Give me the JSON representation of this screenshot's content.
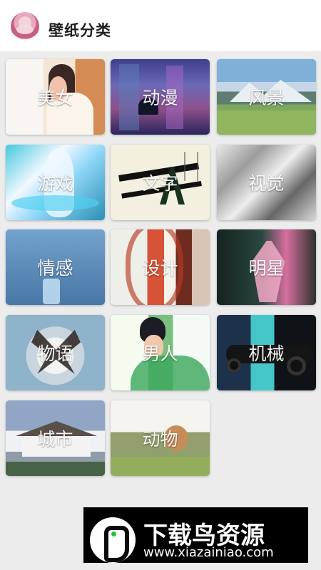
{
  "header": {
    "title": "壁纸分类",
    "avatar_icon": "user-avatar"
  },
  "categories": [
    {
      "label": "美女",
      "art": "t1"
    },
    {
      "label": "动漫",
      "art": "t2"
    },
    {
      "label": "风景",
      "art": "t3"
    },
    {
      "label": "游戏",
      "art": "t4"
    },
    {
      "label": "文字",
      "art": "t5"
    },
    {
      "label": "视觉",
      "art": "t6"
    },
    {
      "label": "情感",
      "art": "t7"
    },
    {
      "label": "设计",
      "art": "t8"
    },
    {
      "label": "明星",
      "art": "t9"
    },
    {
      "label": "物语",
      "art": "t10"
    },
    {
      "label": "男人",
      "art": "t11"
    },
    {
      "label": "机械",
      "art": "t12"
    },
    {
      "label": "城市",
      "art": "t13"
    },
    {
      "label": "动物",
      "art": "t14"
    }
  ],
  "watermark": {
    "name": "下载鸟资源",
    "url": "www.xiazainiao.com"
  },
  "colors": {
    "background": "#ececec",
    "header": "#ffffff",
    "title": "#1f1f1f",
    "banner": "#000000",
    "accent_green": "#24c13b"
  }
}
